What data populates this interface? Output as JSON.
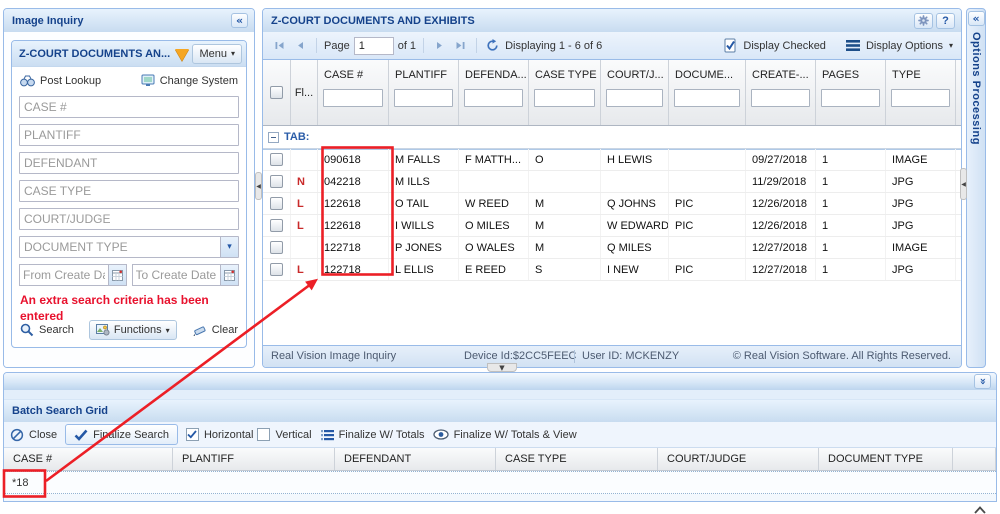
{
  "left_panel": {
    "title": "Image Inquiry",
    "window": {
      "title": "Z-COURT DOCUMENTS AN...",
      "menu_label": "Menu",
      "post_lookup_label": "Post Lookup",
      "change_system_label": "Change System",
      "case_placeholder": "CASE #",
      "plaintiff_placeholder": "PLANTIFF",
      "defendant_placeholder": "DEFENDANT",
      "case_type_placeholder": "CASE TYPE",
      "court_placeholder": "COURT/JUDGE",
      "document_type_value": "DOCUMENT TYPE",
      "from_date_placeholder": "From Create Dat",
      "to_date_placeholder": "To Create Date",
      "warning": "An extra search criteria has been entered",
      "search_label": "Search",
      "functions_label": "Functions",
      "clear_label": "Clear"
    }
  },
  "main": {
    "title": "Z-COURT DOCUMENTS AND EXHIBITS",
    "toolbar": {
      "page_label": "Page",
      "page_value": "1",
      "of_label": "of 1",
      "displaying": "Displaying 1 - 6 of 6",
      "display_checked": "Display Checked",
      "display_options": "Display Options"
    },
    "grid": {
      "columns": [
        {
          "label": "",
          "type": "checkbox",
          "filter": false
        },
        {
          "label": "Fl...",
          "type": "label",
          "filter": false
        },
        {
          "label": "CASE #",
          "filter": true
        },
        {
          "label": "PLANTIFF",
          "filter": true
        },
        {
          "label": "DEFENDA...",
          "filter": true
        },
        {
          "label": "CASE TYPE",
          "filter": true
        },
        {
          "label": "COURT/J...",
          "filter": true
        },
        {
          "label": "DOCUME...",
          "filter": true
        },
        {
          "label": "CREATE-...",
          "filter": true
        },
        {
          "label": "PAGES",
          "filter": true
        },
        {
          "label": "TYPE",
          "filter": true
        }
      ],
      "group_label": "TAB:",
      "rows": [
        {
          "flag": "",
          "cells": [
            "090618",
            "M FALLS",
            "F MATTH...",
            "O",
            "H LEWIS",
            "",
            "09/27/2018",
            "1",
            "IMAGE"
          ]
        },
        {
          "flag": "N",
          "cells": [
            "042218",
            "M ILLS",
            "",
            "",
            "",
            "",
            "11/29/2018",
            "1",
            "JPG"
          ]
        },
        {
          "flag": "L",
          "cells": [
            "122618",
            "O TAIL",
            "W REED",
            "M",
            "Q JOHNS",
            "PIC",
            "12/26/2018",
            "1",
            "JPG"
          ]
        },
        {
          "flag": "L",
          "cells": [
            "122618",
            "I WILLS",
            "O MILES",
            "M",
            "W EDWARD",
            "PIC",
            "12/26/2018",
            "1",
            "JPG"
          ]
        },
        {
          "flag": "",
          "cells": [
            "122718",
            "P JONES",
            "O WALES",
            "M",
            "Q MILES",
            "",
            "12/27/2018",
            "1",
            "IMAGE"
          ]
        },
        {
          "flag": "L",
          "cells": [
            "122718",
            "L ELLIS",
            "E REED",
            "S",
            "I NEW",
            "PIC",
            "12/27/2018",
            "1",
            "JPG"
          ]
        }
      ]
    },
    "statusbar": {
      "left": "Real Vision Image Inquiry",
      "device": "Device Id:$2CC5FEEC",
      "user": "User ID: MCKENZY",
      "right": "© Real Vision Software. All Rights Reserved."
    }
  },
  "right_strip": {
    "title": "Options Processing"
  },
  "bottom_panel": {
    "title": "Batch Search Grid",
    "toolbar": {
      "close_label": "Close",
      "finalize_label": "Finalize Search",
      "horizontal_label": "Horizontal",
      "horizontal_checked": true,
      "vertical_label": "Vertical",
      "vertical_checked": false,
      "totals_label": "Finalize W/ Totals",
      "totals_view_label": "Finalize W/ Totals & View"
    },
    "columns": [
      "CASE #",
      "PLANTIFF",
      "DEFENDANT",
      "CASE TYPE",
      "COURT/JUDGE",
      "DOCUMENT TYPE"
    ],
    "row": [
      "*18",
      "",
      "",
      "",
      "",
      ""
    ]
  },
  "annotations": {
    "color": "#EC1F26"
  }
}
